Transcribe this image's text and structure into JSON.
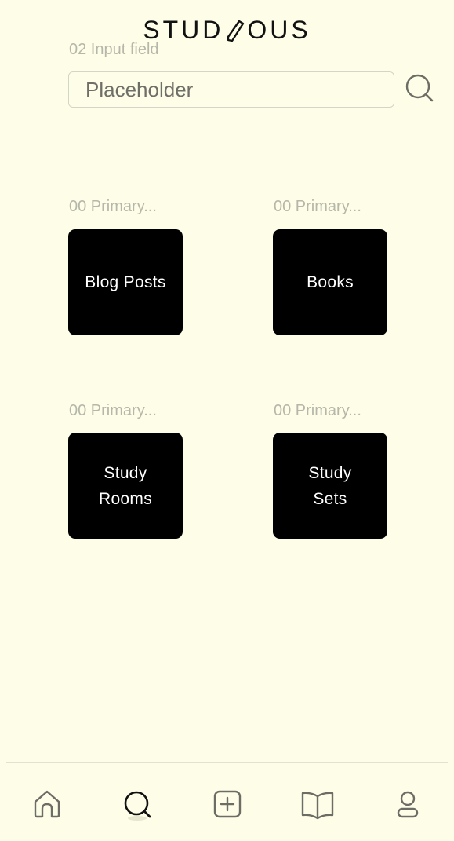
{
  "app": {
    "logo_left": "STUD",
    "logo_right": "OUS"
  },
  "search": {
    "caption": "02 Input field",
    "placeholder": "Placeholder"
  },
  "tiles": [
    {
      "caption": "00 Primary...",
      "label": "Blog Posts"
    },
    {
      "caption": "00 Primary...",
      "label": "Books"
    },
    {
      "caption": "00 Primary...",
      "label": "Study\nRooms"
    },
    {
      "caption": "00 Primary...",
      "label": "Study\nSets"
    }
  ],
  "nav": {
    "items": [
      "home-icon",
      "search-icon",
      "add-icon",
      "book-icon",
      "profile-icon"
    ],
    "active": "search-icon",
    "icon_color": "#6d6d66"
  }
}
